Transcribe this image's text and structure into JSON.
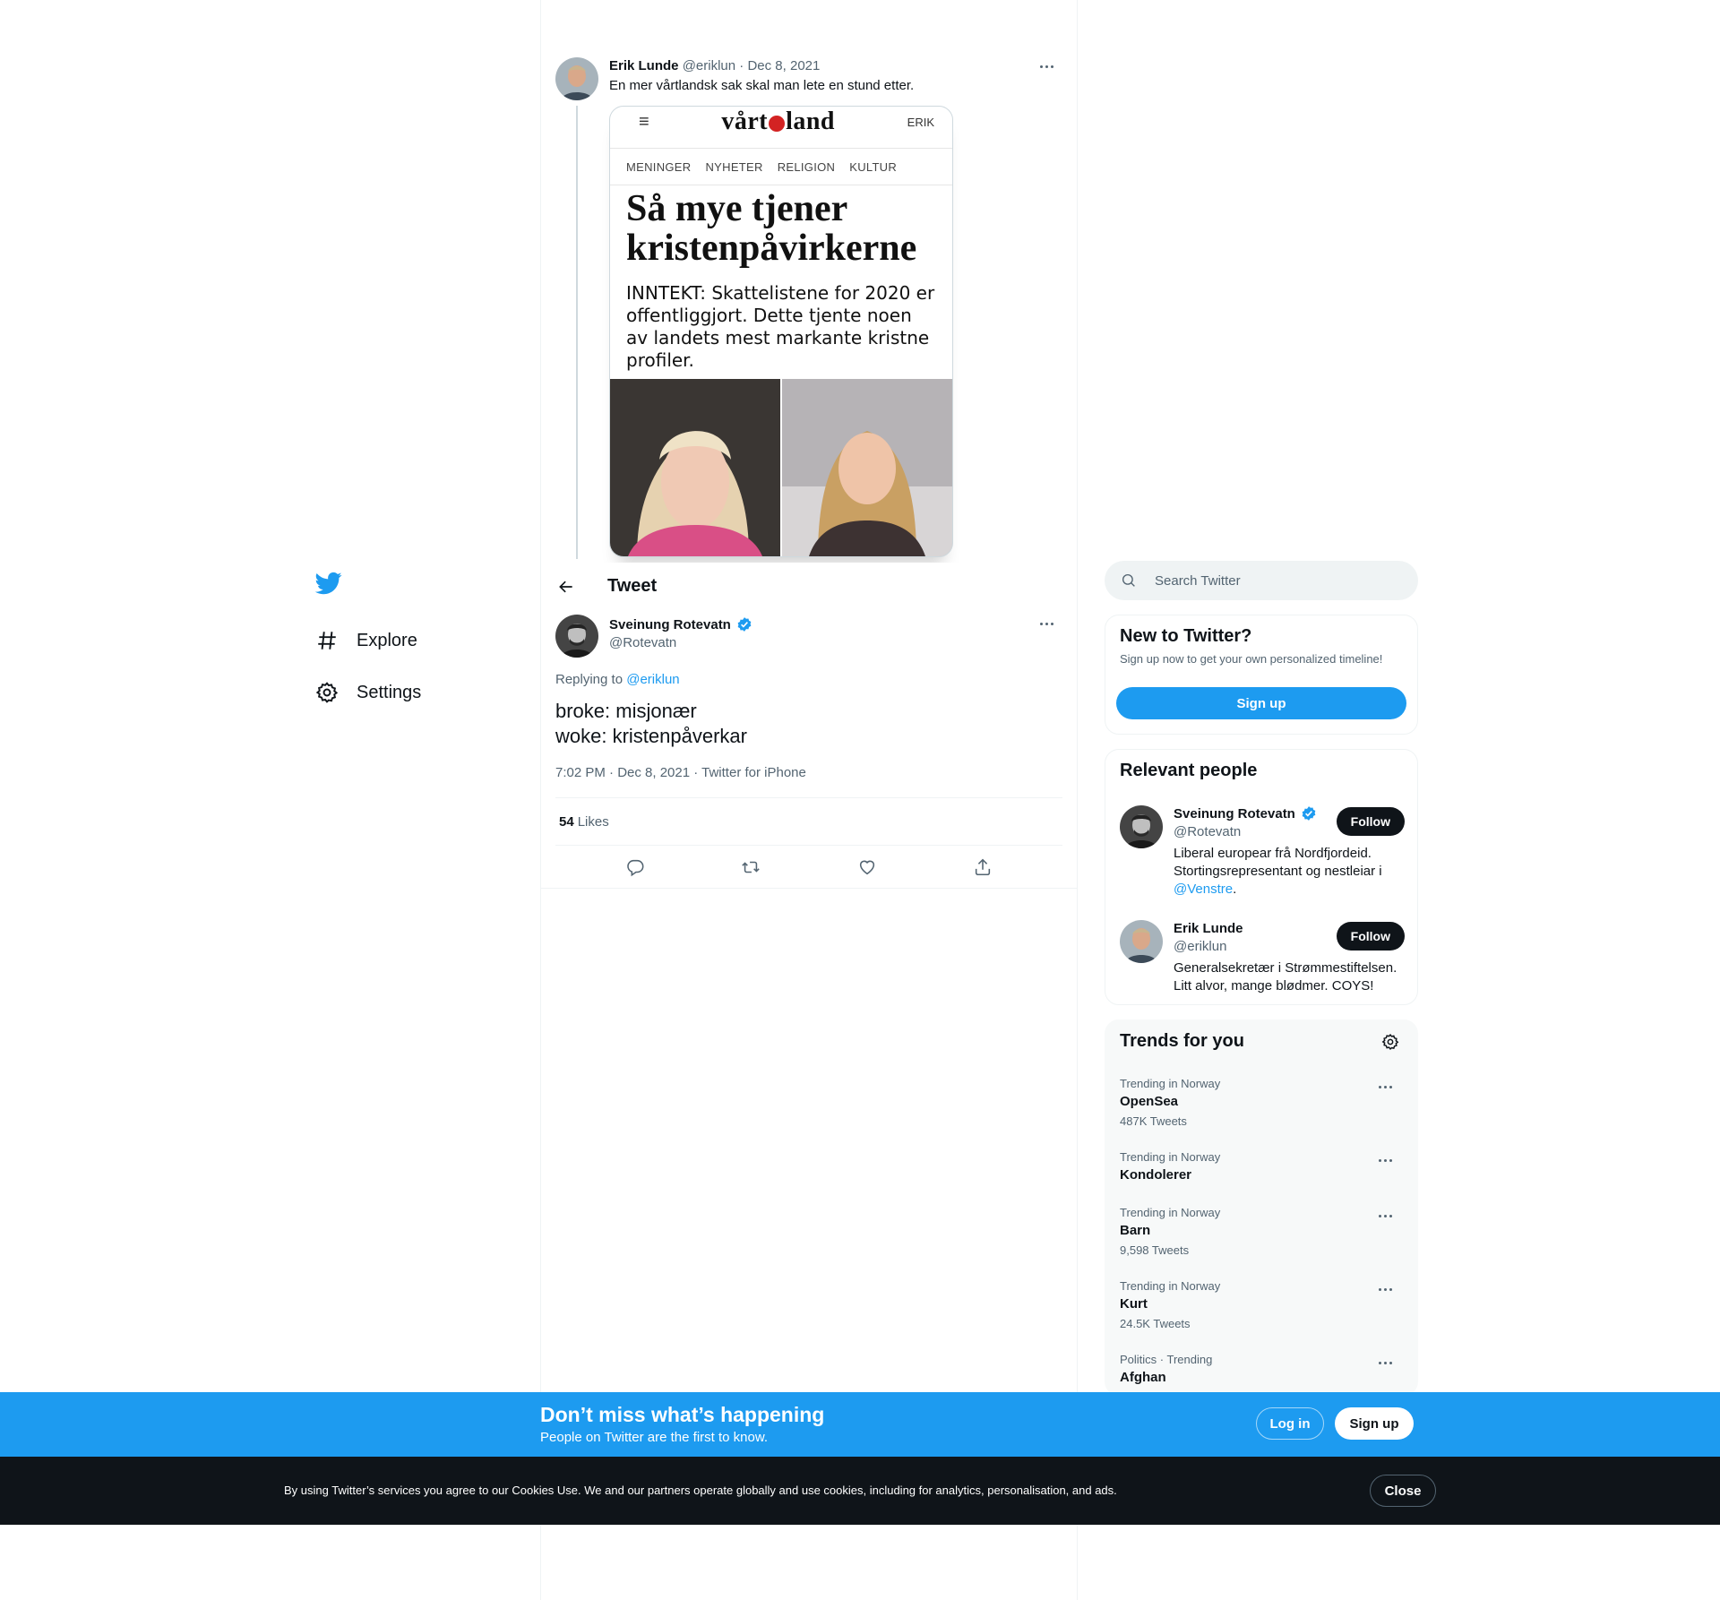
{
  "nav": {
    "explore_label": "Explore",
    "settings_label": "Settings"
  },
  "prev_tweet": {
    "name": "Erik Lunde",
    "handle": "@eriklun",
    "date": "Dec 8, 2021",
    "text": "En mer vårtlandsk sak skal man lete en stund etter.",
    "media": {
      "logo_left": "vårt",
      "logo_right": "land",
      "top_right": "ERIK",
      "menu": [
        "MENINGER",
        "NYHETER",
        "RELIGION",
        "KULTUR"
      ],
      "headline": "Så mye tjener kristenpåvirkerne",
      "lead": "INNTEKT: Skattelistene for 2020 er offentliggjort. Dette tjente noen av landets mest markante kristne profiler."
    }
  },
  "header": {
    "title": "Tweet"
  },
  "tweet": {
    "name": "Sveinung Rotevatn",
    "handle": "@Rotevatn",
    "replying_prefix": "Replying to",
    "replying_to": "@eriklun",
    "line1": "broke: misjonær",
    "line2": "woke: kristenpåverkar",
    "meta": "7:02 PM · Dec 8, 2021 · Twitter for iPhone",
    "likes_count": "54",
    "likes_label": "Likes"
  },
  "search": {
    "placeholder": "Search Twitter"
  },
  "new_to_twitter": {
    "title": "New to Twitter?",
    "subtitle": "Sign up now to get your own personalized timeline!",
    "button": "Sign up"
  },
  "relevant_people": {
    "title": "Relevant people",
    "people": [
      {
        "name": "Sveinung Rotevatn",
        "handle": "@Rotevatn",
        "bio": "Liberal europear frå Nordfjordeid. Stortingsrepresentant og nestleiar i",
        "bio_link": "@Venstre",
        "bio_end": ".",
        "button": "Follow"
      },
      {
        "name": "Erik Lunde",
        "handle": "@eriklun",
        "bio": "Generalsekretær i Strømmestiftelsen. Litt alvor, mange blødmer. COYS!",
        "button": "Follow"
      }
    ]
  },
  "trends": {
    "title": "Trends for you",
    "items": [
      {
        "context": "Trending in Norway",
        "name": "OpenSea",
        "count": "487K Tweets"
      },
      {
        "context": "Trending in Norway",
        "name": "Kondolerer",
        "count": ""
      },
      {
        "context": "Trending in Norway",
        "name": "Barn",
        "count": "9,598 Tweets"
      },
      {
        "context": "Trending in Norway",
        "name": "Kurt",
        "count": "24.5K Tweets"
      },
      {
        "context": "Politics · Trending",
        "name": "Afghan",
        "count": ""
      }
    ]
  },
  "banner": {
    "headline": "Don’t miss what’s happening",
    "sub": "People on Twitter are the first to know.",
    "login": "Log in",
    "signup": "Sign up"
  },
  "cookie": {
    "text": "By using Twitter’s services you agree to our Cookies Use. We and our partners operate globally and use cookies, including for analytics, personalisation, and ads.",
    "close": "Close"
  },
  "colors": {
    "accent": "#1d9bf0",
    "text": "#0f1419",
    "muted": "#536471",
    "cookie_bg": "#0f1419"
  }
}
